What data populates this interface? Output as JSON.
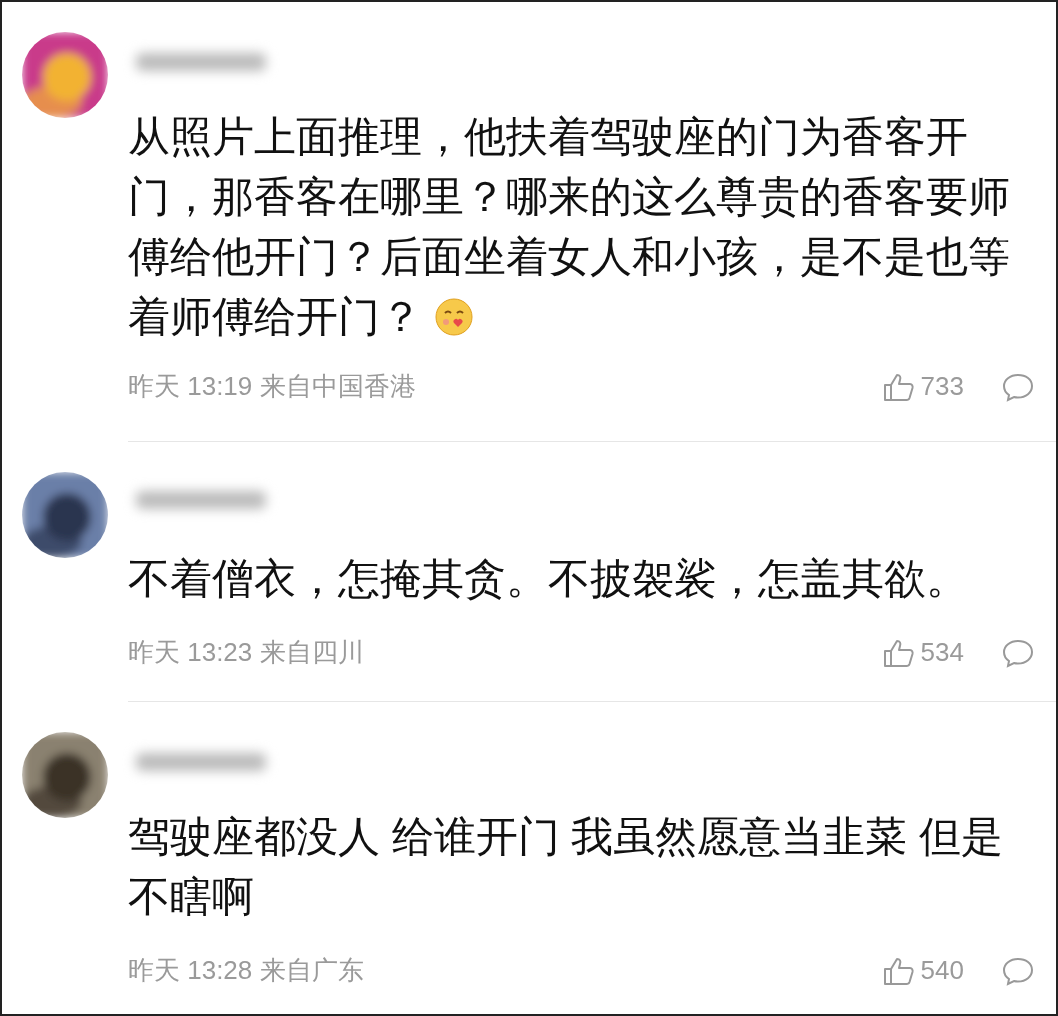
{
  "comments": [
    {
      "text": "从照片上面推理，他扶着驾驶座的门为香客开门，那香客在哪里？哪来的这么尊贵的香客要师傅给他开门？后面坐着女人和小孩，是不是也等着师傅给开门？",
      "has_emoji": true,
      "time": "昨天 13:19 来自中国香港",
      "likes": "733"
    },
    {
      "text": "不着僧衣，怎掩其贪。不披袈裟，怎盖其欲。",
      "time": "昨天 13:23 来自四川",
      "likes": "534"
    },
    {
      "text": "驾驶座都没人 给谁开门 我虽然愿意当韭菜 但是不瞎啊",
      "time": "昨天 13:28 来自广东",
      "likes": "540"
    }
  ]
}
